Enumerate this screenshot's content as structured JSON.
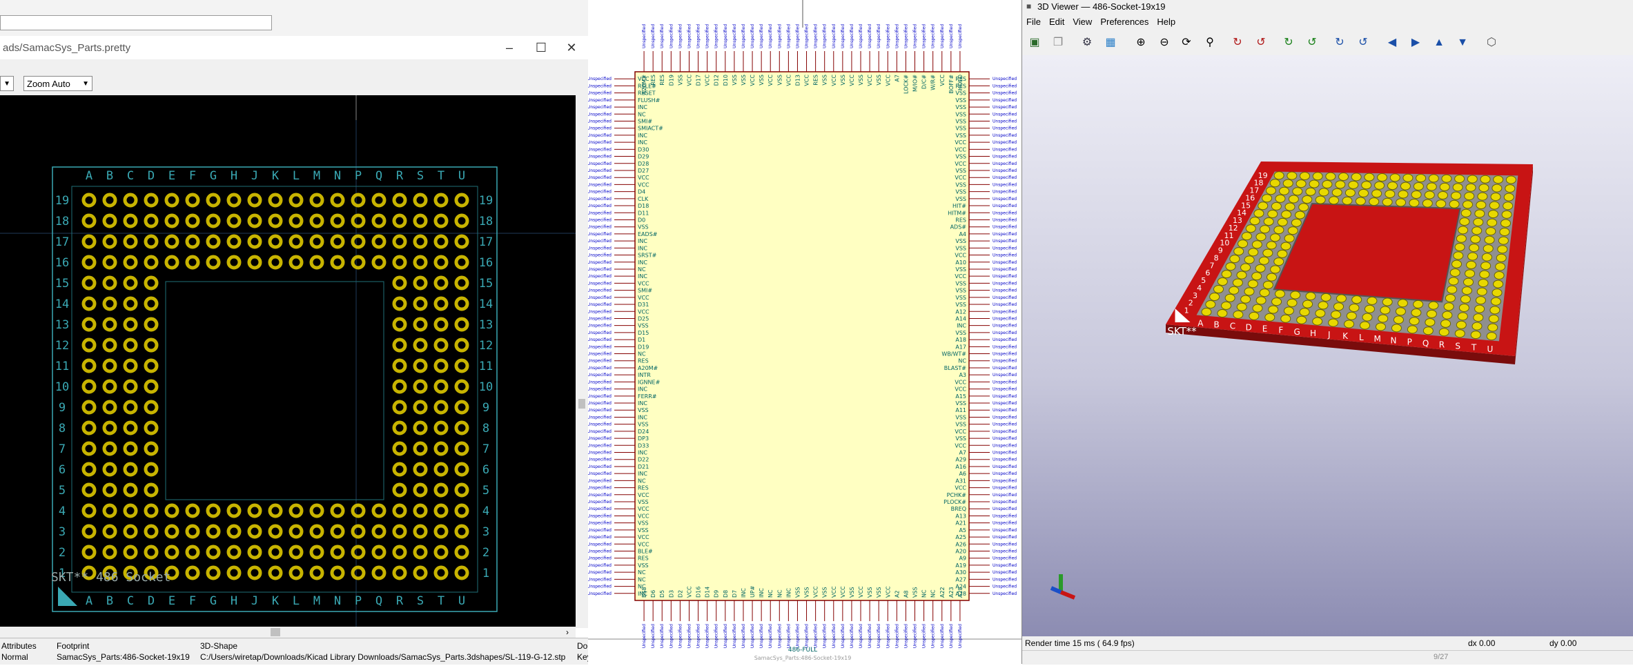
{
  "footprint_viewer": {
    "title": "ads/SamacSys_Parts.pretty",
    "zoom_select": "Zoom Auto",
    "canvas": {
      "columns": [
        "A",
        "B",
        "C",
        "D",
        "E",
        "F",
        "G",
        "H",
        "J",
        "K",
        "L",
        "M",
        "N",
        "P",
        "Q",
        "R",
        "S",
        "T",
        "U"
      ],
      "rows": [
        "19",
        "18",
        "17",
        "16",
        "15",
        "14",
        "13",
        "12",
        "11",
        "10",
        "9",
        "8",
        "7",
        "6",
        "5",
        "4",
        "3",
        "2",
        "1"
      ],
      "reference": "SKT**",
      "value": "486 Socket"
    },
    "status": {
      "attributes_label": "Attributes",
      "attributes_value": "Normal",
      "footprint_label": "Footprint",
      "footprint_value": "SamacSys_Parts:486-Socket-19x19",
      "shape_label": "3D-Shape",
      "shape_value": "C:/Users/wiretap/Downloads/Kicad Library Downloads/SamacSys_Parts.3dshapes/SL-119-G-12.stp",
      "extra_label": "Do",
      "extra_value": "Key"
    }
  },
  "schematic": {
    "ref": "486-FULL",
    "footprint": "SamacSys_Parts:486-Socket-19x19",
    "left_pin_names": [
      "VCC",
      "RSLE#",
      "RESET",
      "FLUSH#",
      "INC",
      "NC",
      "SMI#",
      "SMIACT#",
      "INC",
      "INC",
      "D30",
      "D29",
      "D28",
      "D27",
      "VCC",
      "VCC",
      "D4",
      "CLK",
      "D18",
      "D11",
      "D0",
      "VSS",
      "EADS#",
      "INC",
      "INC",
      "SRST#",
      "INC",
      "NC",
      "INC",
      "VCC",
      "SMI#",
      "VCC",
      "D31",
      "VCC",
      "D25",
      "VSS",
      "D15",
      "D1",
      "D19",
      "NC",
      "RES",
      "A20M#",
      "INTR",
      "IGNNE#",
      "INC",
      "FERR#",
      "INC",
      "VSS",
      "INC",
      "VSS",
      "D24",
      "DP3",
      "D33",
      "INC",
      "D22",
      "D21",
      "INC",
      "NC",
      "RES",
      "VCC",
      "VSS",
      "VCC",
      "VCC",
      "VSS",
      "VSS",
      "VCC",
      "VCC",
      "BLE#",
      "RES",
      "VSS",
      "NC",
      "NC",
      "NC",
      "INC"
    ],
    "right_pin_names": [
      "RES",
      "RES",
      "VSS",
      "VSS",
      "VSS",
      "VSS",
      "VSS",
      "VSS",
      "VSS",
      "VCC",
      "VCC",
      "VSS",
      "VCC",
      "VSS",
      "VCC",
      "VSS",
      "VSS",
      "VSS",
      "HIT#",
      "HITM#",
      "RES",
      "ADS#",
      "A4",
      "VSS",
      "VSS",
      "VCC",
      "A10",
      "VSS",
      "VCC",
      "VSS",
      "VSS",
      "VSS",
      "VSS",
      "A12",
      "A14",
      "INC",
      "VSS",
      "A18",
      "A17",
      "WB/WT#",
      "NC",
      "BLAST#",
      "A3",
      "VCC",
      "VCC",
      "A15",
      "VSS",
      "A11",
      "VSS",
      "VSS",
      "VCC",
      "VSS",
      "VCC",
      "A7",
      "A29",
      "A16",
      "A6",
      "A31",
      "VCC",
      "PCHK#",
      "PLOCK#",
      "BREQ",
      "A13",
      "A21",
      "A5",
      "A25",
      "A26",
      "A20",
      "A9",
      "A19",
      "A30",
      "A27",
      "A24",
      "A28"
    ],
    "top_pin_names": [
      "A20M#",
      "RES",
      "RES",
      "D19",
      "VSS",
      "VCC",
      "D17",
      "VCC",
      "D12",
      "D10",
      "VSS",
      "VSS",
      "VCC",
      "VSS",
      "VCC",
      "VSS",
      "VCC",
      "D13",
      "VCC",
      "RES",
      "VSS",
      "VCC",
      "VSS",
      "VCC",
      "VSS",
      "VCC",
      "VSS",
      "VCC",
      "A7",
      "LOCK#",
      "M/IO#",
      "D/C#",
      "W/R#",
      "VCC",
      "BOFF#",
      "HOLD"
    ],
    "bottom_pin_names": [
      "BS8",
      "D6",
      "D5",
      "D3",
      "D2",
      "VCC",
      "D16",
      "D14",
      "D9",
      "D8",
      "D7",
      "INC",
      "UP#",
      "INC",
      "NC",
      "NC",
      "INC",
      "VSS",
      "VSS",
      "VCC",
      "VSS",
      "VCC",
      "VCC",
      "VSS",
      "VCC",
      "VSS",
      "VSS",
      "VCC",
      "A2",
      "A8",
      "VSS",
      "NC",
      "NC",
      "A22",
      "A23",
      "A28"
    ]
  },
  "viewer3d": {
    "title": "3D Viewer — 486-Socket-19x19",
    "menu": [
      "File",
      "Edit",
      "View",
      "Preferences",
      "Help"
    ],
    "reference": "SKT**",
    "columns": [
      "A",
      "B",
      "C",
      "D",
      "E",
      "F",
      "G",
      "H",
      "J",
      "K",
      "L",
      "M",
      "N",
      "P",
      "Q",
      "R",
      "S",
      "T",
      "U"
    ],
    "rows": [
      "19",
      "18",
      "17",
      "16",
      "15",
      "14",
      "13",
      "12",
      "11",
      "10",
      "9",
      "8",
      "7",
      "6",
      "5",
      "4",
      "3",
      "2",
      "1"
    ],
    "status_render": "Render time 15 ms ( 64.9 fps)",
    "dx": "dx 0.00",
    "dy": "dy 0.00",
    "page": "9/27"
  },
  "colors": {
    "pcb_bg": "#000000",
    "pad_yellow": "#c8b400",
    "silk_cyan": "#3aa9b4",
    "symbol_body": "#ffffc2",
    "symbol_outline": "#840000",
    "pin_label_blue": "#0000c8",
    "pin_name_teal": "#006464",
    "board_red": "#c81414"
  }
}
